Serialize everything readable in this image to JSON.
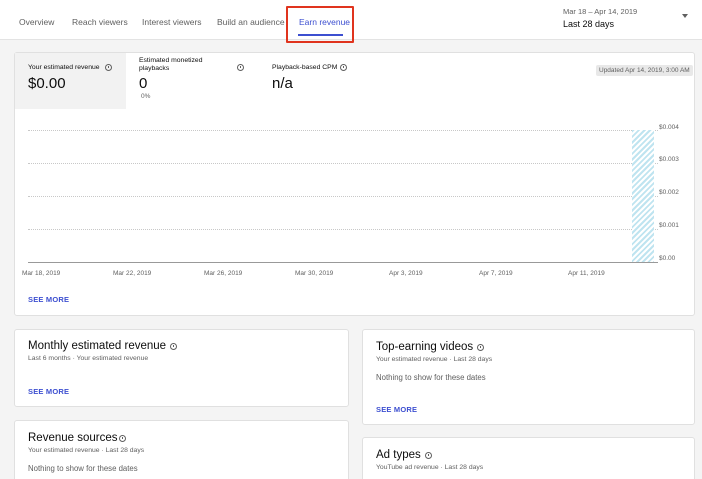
{
  "tabs": [
    {
      "label": "Overview"
    },
    {
      "label": "Reach viewers"
    },
    {
      "label": "Interest viewers"
    },
    {
      "label": "Build an audience"
    },
    {
      "label": "Earn revenue"
    }
  ],
  "date_selector": {
    "range": "Mar 18 – Apr 14, 2019",
    "preset": "Last 28 days"
  },
  "metrics": [
    {
      "label": "Your estimated revenue",
      "value": "$0.00",
      "sub": ""
    },
    {
      "label": "Estimated monetized playbacks",
      "value": "0",
      "sub": "0%"
    },
    {
      "label": "Playback-based CPM",
      "value": "n/a",
      "sub": ""
    }
  ],
  "updated": "Updated Apr 14, 2019, 3:00 AM",
  "chart_data": {
    "type": "bar",
    "x_ticks": [
      "Mar 18, 2019",
      "Mar 22, 2019",
      "Mar 26, 2019",
      "Mar 30, 2019",
      "Apr 3, 2019",
      "Apr 7, 2019",
      "Apr 11, 2019"
    ],
    "y_ticks": [
      "$0.004",
      "$0.003",
      "$0.002",
      "$0.001",
      "$0.00"
    ],
    "ylim": [
      0,
      0.004
    ],
    "values": [
      0
    ],
    "grid": true
  },
  "see_more": "SEE MORE",
  "cards": {
    "monthly": {
      "title": "Monthly estimated revenue",
      "sub": "Last 6 months · Your estimated revenue",
      "link": "SEE MORE"
    },
    "top_videos": {
      "title": "Top-earning videos",
      "sub": "Your estimated revenue · Last 28 days",
      "note": "Nothing to show for these dates",
      "link": "SEE MORE"
    },
    "sources": {
      "title": "Revenue sources",
      "sub": "Your estimated revenue · Last 28 days",
      "note": "Nothing to show for these dates"
    },
    "ad_types": {
      "title": "Ad types",
      "sub": "YouTube ad revenue · Last 28 days"
    }
  },
  "colors": {
    "accent": "#3d4fd0",
    "highlight": "#e0341e",
    "projection": "#bfe4f0"
  }
}
